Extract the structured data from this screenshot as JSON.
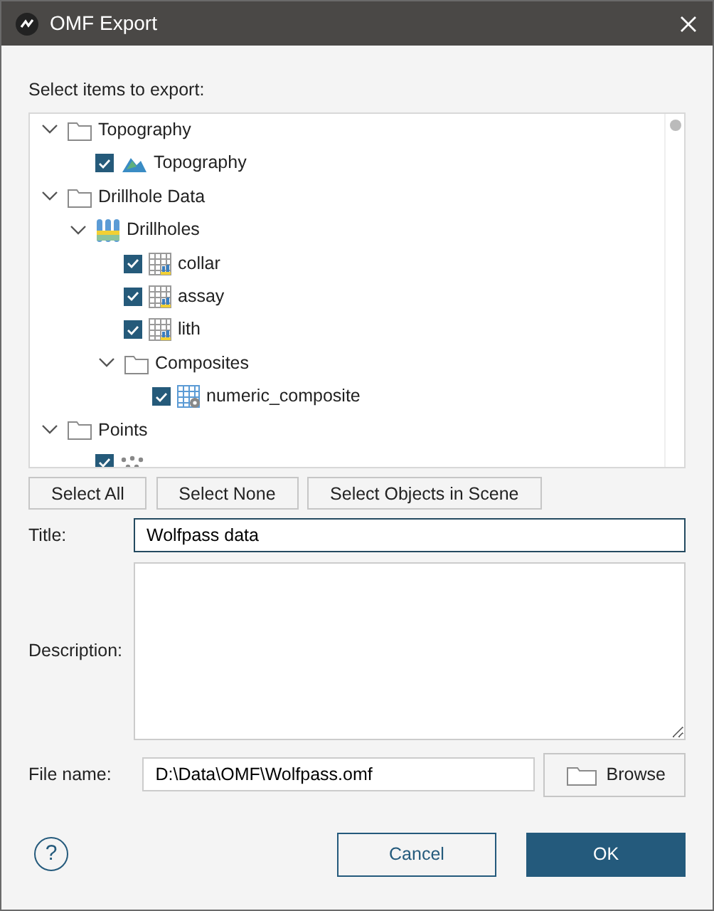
{
  "window": {
    "title": "OMF Export"
  },
  "tree_label": "Select items to export:",
  "tree": [
    {
      "kind": "folder",
      "label": "Topography",
      "expanded": true,
      "children": [
        {
          "kind": "surface",
          "label": "Topography",
          "checked": true
        }
      ]
    },
    {
      "kind": "folder",
      "label": "Drillhole Data",
      "expanded": true,
      "children": [
        {
          "kind": "drillholes",
          "label": "Drillholes",
          "expanded": true,
          "children": [
            {
              "kind": "table",
              "label": "collar",
              "checked": true
            },
            {
              "kind": "table",
              "label": "assay",
              "checked": true
            },
            {
              "kind": "table",
              "label": "lith",
              "checked": true
            },
            {
              "kind": "folder",
              "label": "Composites",
              "expanded": true,
              "children": [
                {
                  "kind": "composite",
                  "label": "numeric_composite",
                  "checked": true
                }
              ]
            }
          ]
        }
      ]
    },
    {
      "kind": "folder",
      "label": "Points",
      "expanded": true,
      "children": [
        {
          "kind": "points",
          "checked": true
        }
      ]
    }
  ],
  "selection_buttons": [
    "Select All",
    "Select None",
    "Select Objects in Scene"
  ],
  "title_field": {
    "label": "Title:",
    "value": "Wolfpass data"
  },
  "description_field": {
    "label": "Description:"
  },
  "file_field": {
    "label": "File name:",
    "value": "D:\\Data\\OMF\\Wolfpass.omf",
    "button": "Browse"
  },
  "footer": {
    "help": "?",
    "cancel": "Cancel",
    "ok": "OK"
  }
}
